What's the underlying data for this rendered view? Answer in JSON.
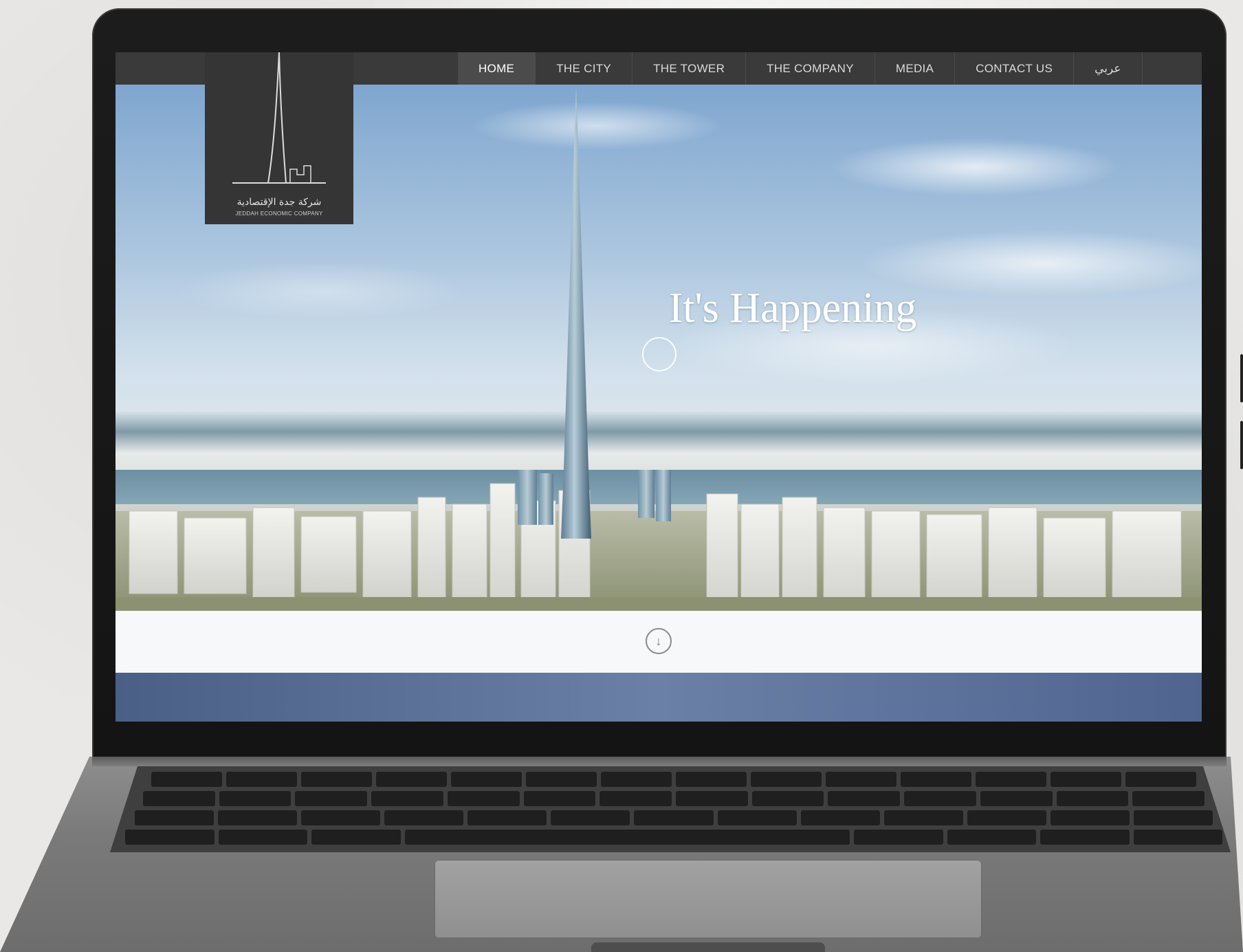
{
  "nav": {
    "items": [
      {
        "label": "HOME",
        "active": true
      },
      {
        "label": "THE CITY",
        "active": false
      },
      {
        "label": "THE TOWER",
        "active": false
      },
      {
        "label": "THE COMPANY",
        "active": false
      },
      {
        "label": "MEDIA",
        "active": false
      },
      {
        "label": "CONTACT US",
        "active": false
      },
      {
        "label": "عربي",
        "active": false
      }
    ]
  },
  "logo": {
    "arabic": "شركة جدة الإقتصادية",
    "english": "JEDDAH ECONOMIC COMPANY"
  },
  "hero": {
    "title": "It's Happening"
  },
  "icons": {
    "play": "play-circle-icon",
    "scroll": "arrow-down-circle-icon"
  },
  "colors": {
    "nav_bg": "#3a3a3a",
    "logo_bg": "#353535",
    "blue_band": "#4a5f86"
  }
}
